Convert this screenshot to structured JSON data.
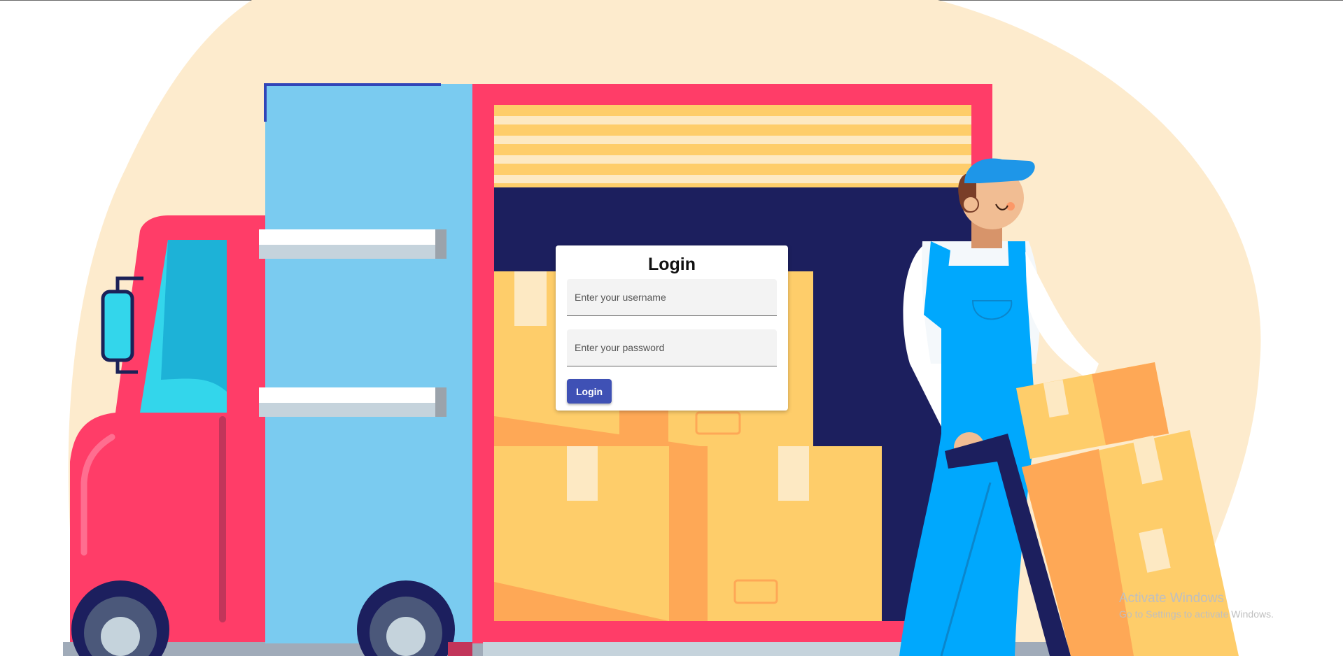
{
  "colors": {
    "backdrop": "#fdebcd",
    "truck_red": "#ff3d68",
    "truck_blue": "#7acbf0",
    "cargo_dark": "#1c1f5e",
    "box_yellow": "#fecd6a",
    "box_orange": "#fea856",
    "worker_blue": "#00a8fd",
    "button": "#3f51b5"
  },
  "login": {
    "title": "Login",
    "username_placeholder": "Enter your username",
    "username_value": "",
    "password_placeholder": "Enter your password",
    "password_value": "",
    "button_label": "Login"
  },
  "watermark": {
    "title": "Activate Windows",
    "subtitle": "Go to Settings to activate Windows."
  }
}
